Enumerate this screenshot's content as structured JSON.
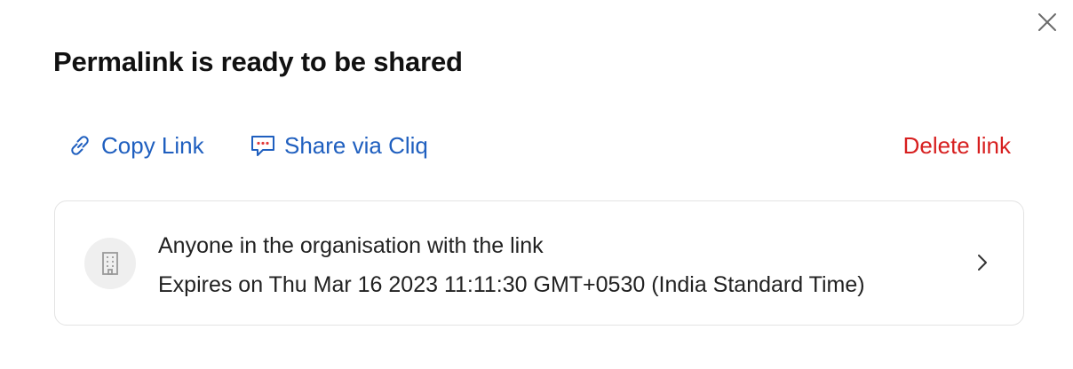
{
  "dialog": {
    "title": "Permalink is ready to be shared",
    "close_icon": "close-icon"
  },
  "actions": {
    "copy_link": {
      "label": "Copy Link",
      "icon": "link-icon"
    },
    "share_cliq": {
      "label": "Share via Cliq",
      "icon": "chat-bubble-icon"
    },
    "delete_link": {
      "label": "Delete link"
    }
  },
  "access": {
    "icon": "building-icon",
    "scope": "Anyone in the organisation with the link",
    "expiry": "Expires on Thu Mar 16 2023 11:11:30 GMT+0530 (India Standard Time)",
    "chevron_icon": "chevron-right-icon"
  },
  "colors": {
    "link_blue": "#1f5fbf",
    "danger_red": "#d71f1f",
    "title_text": "#111111",
    "card_border": "#e3e3e3",
    "avatar_bg": "#efefef"
  }
}
